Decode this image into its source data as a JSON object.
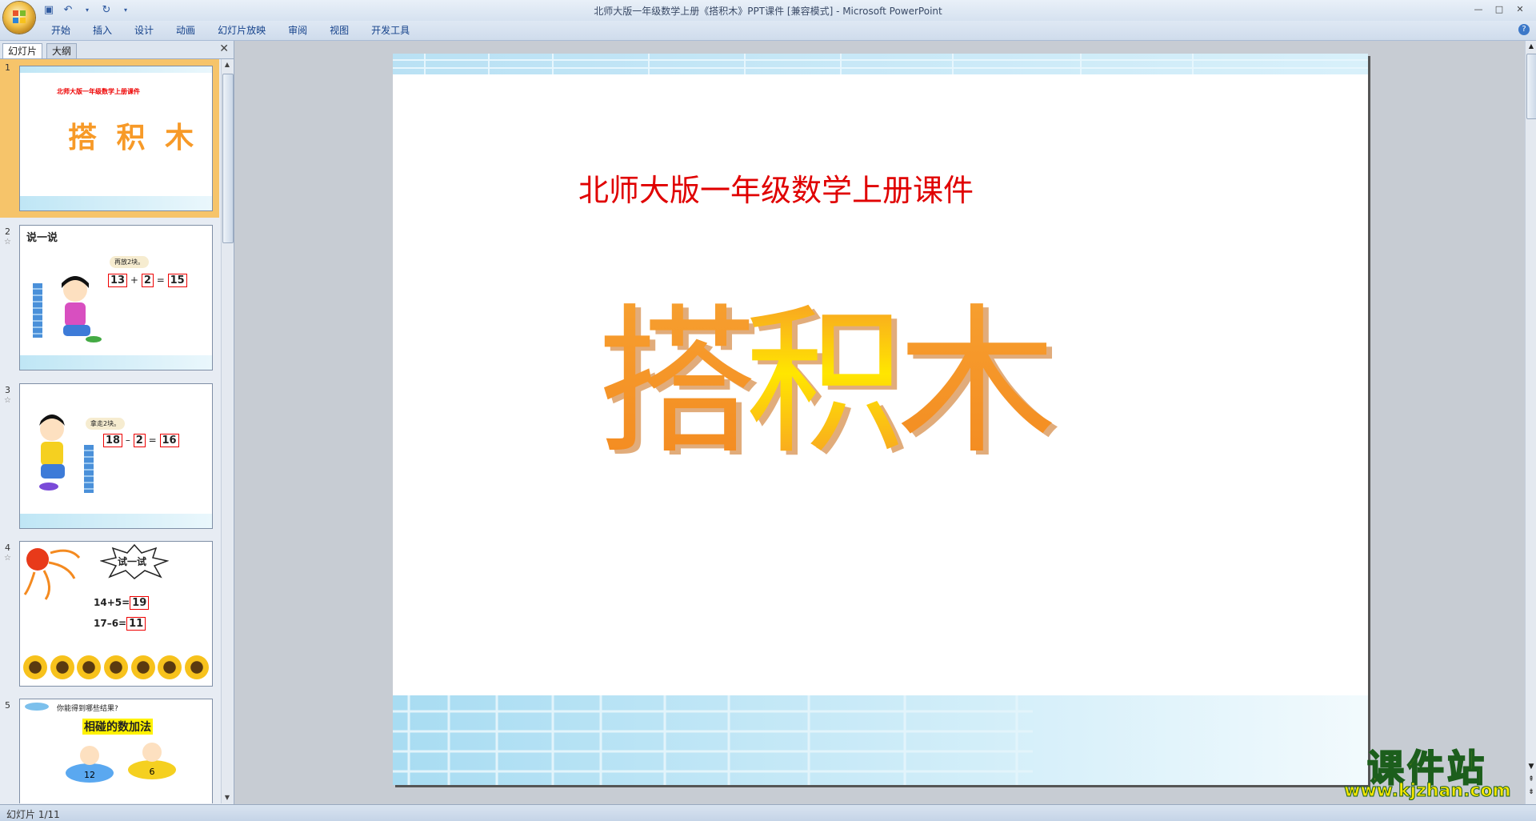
{
  "window": {
    "title": "北师大版一年级数学上册《搭积木》PPT课件 [兼容模式] - Microsoft PowerPoint",
    "controls": [
      "—",
      "□",
      "✕"
    ]
  },
  "ribbon": {
    "tabs": [
      "开始",
      "插入",
      "设计",
      "动画",
      "幻灯片放映",
      "审阅",
      "视图",
      "开发工具"
    ]
  },
  "left_pane": {
    "tabs": [
      "幻灯片",
      "大纲"
    ],
    "slides": [
      {
        "num": "1",
        "subtitle": "北师大版一年级数学上册课件",
        "title": "搭 积 木"
      },
      {
        "num": "2",
        "heading": "说一说",
        "bubble": "再放2块。",
        "eq": [
          "13",
          "+",
          "2",
          "=",
          "15"
        ]
      },
      {
        "num": "3",
        "bubble": "拿走2块。",
        "eq": [
          "18",
          "–",
          "2",
          "=",
          "16"
        ]
      },
      {
        "num": "4",
        "burst": "试一试",
        "lines": [
          {
            "expr": "14+5=",
            "ans": "19"
          },
          {
            "expr": "17–6=",
            "ans": "11"
          }
        ]
      },
      {
        "num": "5",
        "prompt": "你能得到哪些结果?",
        "title": "相碰的数加法",
        "cars": [
          "12",
          "6"
        ]
      }
    ]
  },
  "main_slide": {
    "subtitle": "北师大版一年级数学上册课件",
    "title_chars": [
      "搭",
      "积",
      "木"
    ]
  },
  "status": {
    "text": "幻灯片 1/11"
  },
  "watermark": {
    "big": "课件站",
    "url": "www.kjzhan.com"
  },
  "colors": {
    "title_orange": "#f79a28",
    "title_yellow": "#ffe600",
    "subtitle_red": "#e00000",
    "selection": "#f6c46a"
  }
}
